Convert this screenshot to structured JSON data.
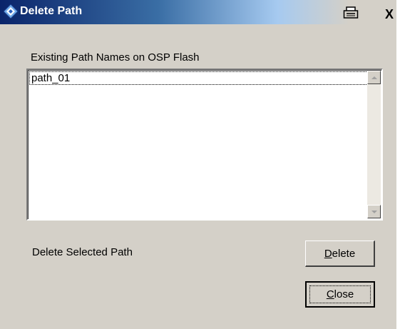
{
  "window": {
    "title": "Delete Path",
    "close_glyph": "X",
    "icons": [
      "app-diamond-icon",
      "printer-icon",
      "close-icon"
    ]
  },
  "list": {
    "label": "Existing Path Names on OSP Flash",
    "items": [
      "path_01"
    ],
    "selected_index": 0
  },
  "actions": {
    "delete_prompt": "Delete Selected Path",
    "delete_button": {
      "mnemonic": "D",
      "rest": "elete"
    },
    "close_button": {
      "mnemonic": "C",
      "rest": "lose"
    }
  },
  "colors": {
    "title_start": "#0a246a",
    "title_mid": "#3a6ea5",
    "face": "#d4d0c8"
  }
}
